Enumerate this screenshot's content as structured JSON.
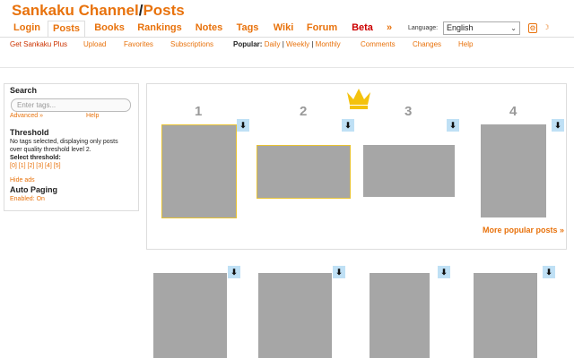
{
  "site": {
    "title_main": "Sankaku Channel",
    "title_slash": "/",
    "title_sub": "Posts"
  },
  "nav": {
    "tabs": [
      {
        "label": "Login"
      },
      {
        "label": "Posts"
      },
      {
        "label": "Books"
      },
      {
        "label": "Rankings"
      },
      {
        "label": "Notes"
      },
      {
        "label": "Tags"
      },
      {
        "label": "Wiki"
      },
      {
        "label": "Forum"
      },
      {
        "label": "Beta"
      },
      {
        "label": "»"
      }
    ],
    "language_label": "Language:",
    "language_value": "English",
    "language_caret": "⌄",
    "settings_icon": "⚙",
    "theme_icon": "☽"
  },
  "subnav": {
    "items": [
      {
        "label": "Get Sankaku Plus"
      },
      {
        "label": "Upload"
      },
      {
        "label": "Favorites"
      },
      {
        "label": "Subscriptions"
      },
      {
        "label": "Comments"
      },
      {
        "label": "Changes"
      },
      {
        "label": "Help"
      }
    ],
    "popular_label": "Popular:",
    "popular_daily": "Daily",
    "popular_weekly": "Weekly",
    "popular_monthly": "Monthly",
    "separator": "|"
  },
  "sidebar": {
    "search_heading": "Search",
    "search_placeholder": "Enter tags...",
    "advanced": "Advanced »",
    "help": "Help",
    "threshold_heading": "Threshold",
    "threshold_text_1": "No tags selected, displaying only posts",
    "threshold_text_2": "over quality threshold level 2.",
    "select_threshold": "Select threshold:",
    "threshold_options": [
      "[0]",
      "[1]",
      "[2]",
      "[3]",
      "[4]",
      "[5]"
    ],
    "hide_ads": "Hide ads",
    "auto_paging_heading": "Auto Paging",
    "auto_paging_status": "Enabled: On"
  },
  "popular": {
    "ranks": [
      "1",
      "2",
      "3",
      "4"
    ],
    "more_link": "More popular posts »",
    "download_icon": "⬇"
  }
}
